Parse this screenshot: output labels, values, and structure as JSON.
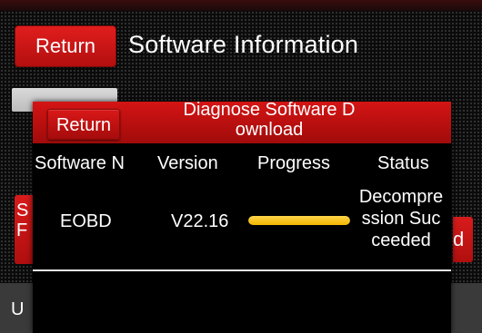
{
  "header": {
    "return_label": "Return",
    "title": "Software Information"
  },
  "background": {
    "left_button_text": "S\nF",
    "right_button_text": "d",
    "bottom_bar_text": "U"
  },
  "dialog": {
    "return_label": "Return",
    "title": "Diagnose Software Download",
    "columns": [
      "Software N",
      "Version",
      "Progress",
      "Status"
    ],
    "rows": [
      {
        "software": "EOBD",
        "version": "V22.16",
        "progress": 1.0,
        "status": "Decompression Succeeded"
      }
    ]
  },
  "colors": {
    "accent_red": "#c81212",
    "progress_yellow": "#f5bb00",
    "dialog_bg": "#000000"
  }
}
